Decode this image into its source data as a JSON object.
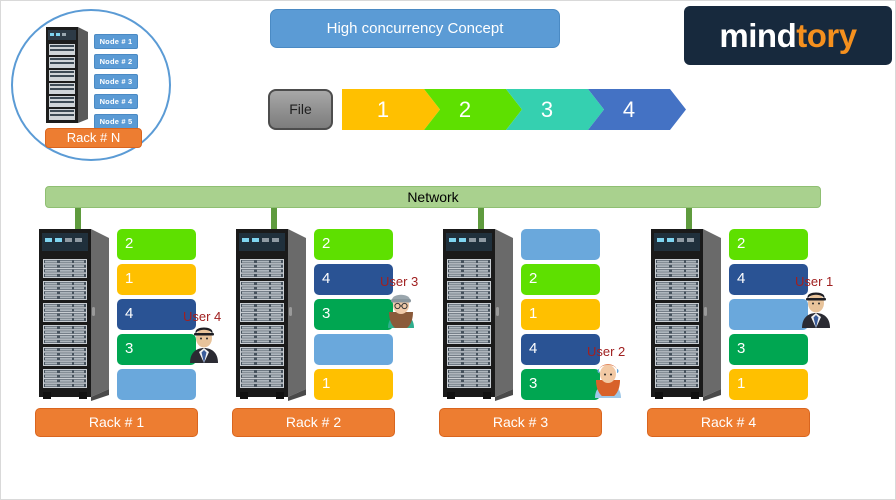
{
  "header": {
    "title": "High concurrency Concept",
    "logo_text_primary": "mind",
    "logo_text_accent": "tory",
    "logo_bg": "#17293D",
    "logo_accent_color": "#F5901E",
    "title_bg": "#5B9BD5"
  },
  "flow": {
    "file_label": "File",
    "chevrons": [
      {
        "label": "1",
        "color": "#FFC000"
      },
      {
        "label": "2",
        "color": "#5EE000"
      },
      {
        "label": "3",
        "color": "#35D0B0"
      },
      {
        "label": "4",
        "color": "#4472C4"
      }
    ]
  },
  "legend": {
    "ellipse_border_color": "#5B9BD5",
    "rack_label": "Rack # N",
    "nodes": [
      {
        "label": "Node # 1"
      },
      {
        "label": "Node # 2"
      },
      {
        "label": "Node # 3"
      },
      {
        "label": "Node # 4"
      },
      {
        "label": "Node # 5"
      }
    ]
  },
  "network": {
    "label": "Network",
    "bar_color": "#A9D18E",
    "stem_color": "#5F9B3E"
  },
  "palette": {
    "block_green_bright": "#5EE000",
    "block_amber": "#FFC000",
    "block_navy": "#2A5394",
    "block_green": "#00A651",
    "block_lightblue": "#6AA8DC",
    "rack_orange": "#ED7D31",
    "user_text": "#A02020"
  },
  "racks": [
    {
      "label": "Rack # 1",
      "blocks": [
        {
          "label": "2",
          "color": "#5EE000"
        },
        {
          "label": "1",
          "color": "#FFC000"
        },
        {
          "label": "4",
          "color": "#2A5394"
        },
        {
          "label": "3",
          "color": "#00A651"
        },
        {
          "label": "",
          "color": "#6AA8DC"
        }
      ],
      "user": {
        "name": "User 4",
        "avatar": "businessman-avatar",
        "block_index": 2
      }
    },
    {
      "label": "Rack # 2",
      "blocks": [
        {
          "label": "2",
          "color": "#5EE000"
        },
        {
          "label": "4",
          "color": "#2A5394"
        },
        {
          "label": "3",
          "color": "#00A651"
        },
        {
          "label": "",
          "color": "#6AA8DC"
        },
        {
          "label": "1",
          "color": "#FFC000"
        }
      ],
      "user": {
        "name": "User 3",
        "avatar": "woman-beanie-avatar",
        "block_index": 1
      }
    },
    {
      "label": "Rack # 3",
      "blocks": [
        {
          "label": "",
          "color": "#6AA8DC"
        },
        {
          "label": "2",
          "color": "#5EE000"
        },
        {
          "label": "1",
          "color": "#FFC000"
        },
        {
          "label": "4",
          "color": "#2A5394"
        },
        {
          "label": "3",
          "color": "#00A651"
        }
      ],
      "user": {
        "name": "User 2",
        "avatar": "woman-redhair-avatar",
        "block_index": 3
      }
    },
    {
      "label": "Rack # 4",
      "blocks": [
        {
          "label": "2",
          "color": "#5EE000"
        },
        {
          "label": "4",
          "color": "#2A5394"
        },
        {
          "label": "",
          "color": "#6AA8DC"
        },
        {
          "label": "3",
          "color": "#00A651"
        },
        {
          "label": "1",
          "color": "#FFC000"
        }
      ],
      "user": {
        "name": "User 1",
        "avatar": "businessman-avatar",
        "block_index": 1
      }
    }
  ]
}
